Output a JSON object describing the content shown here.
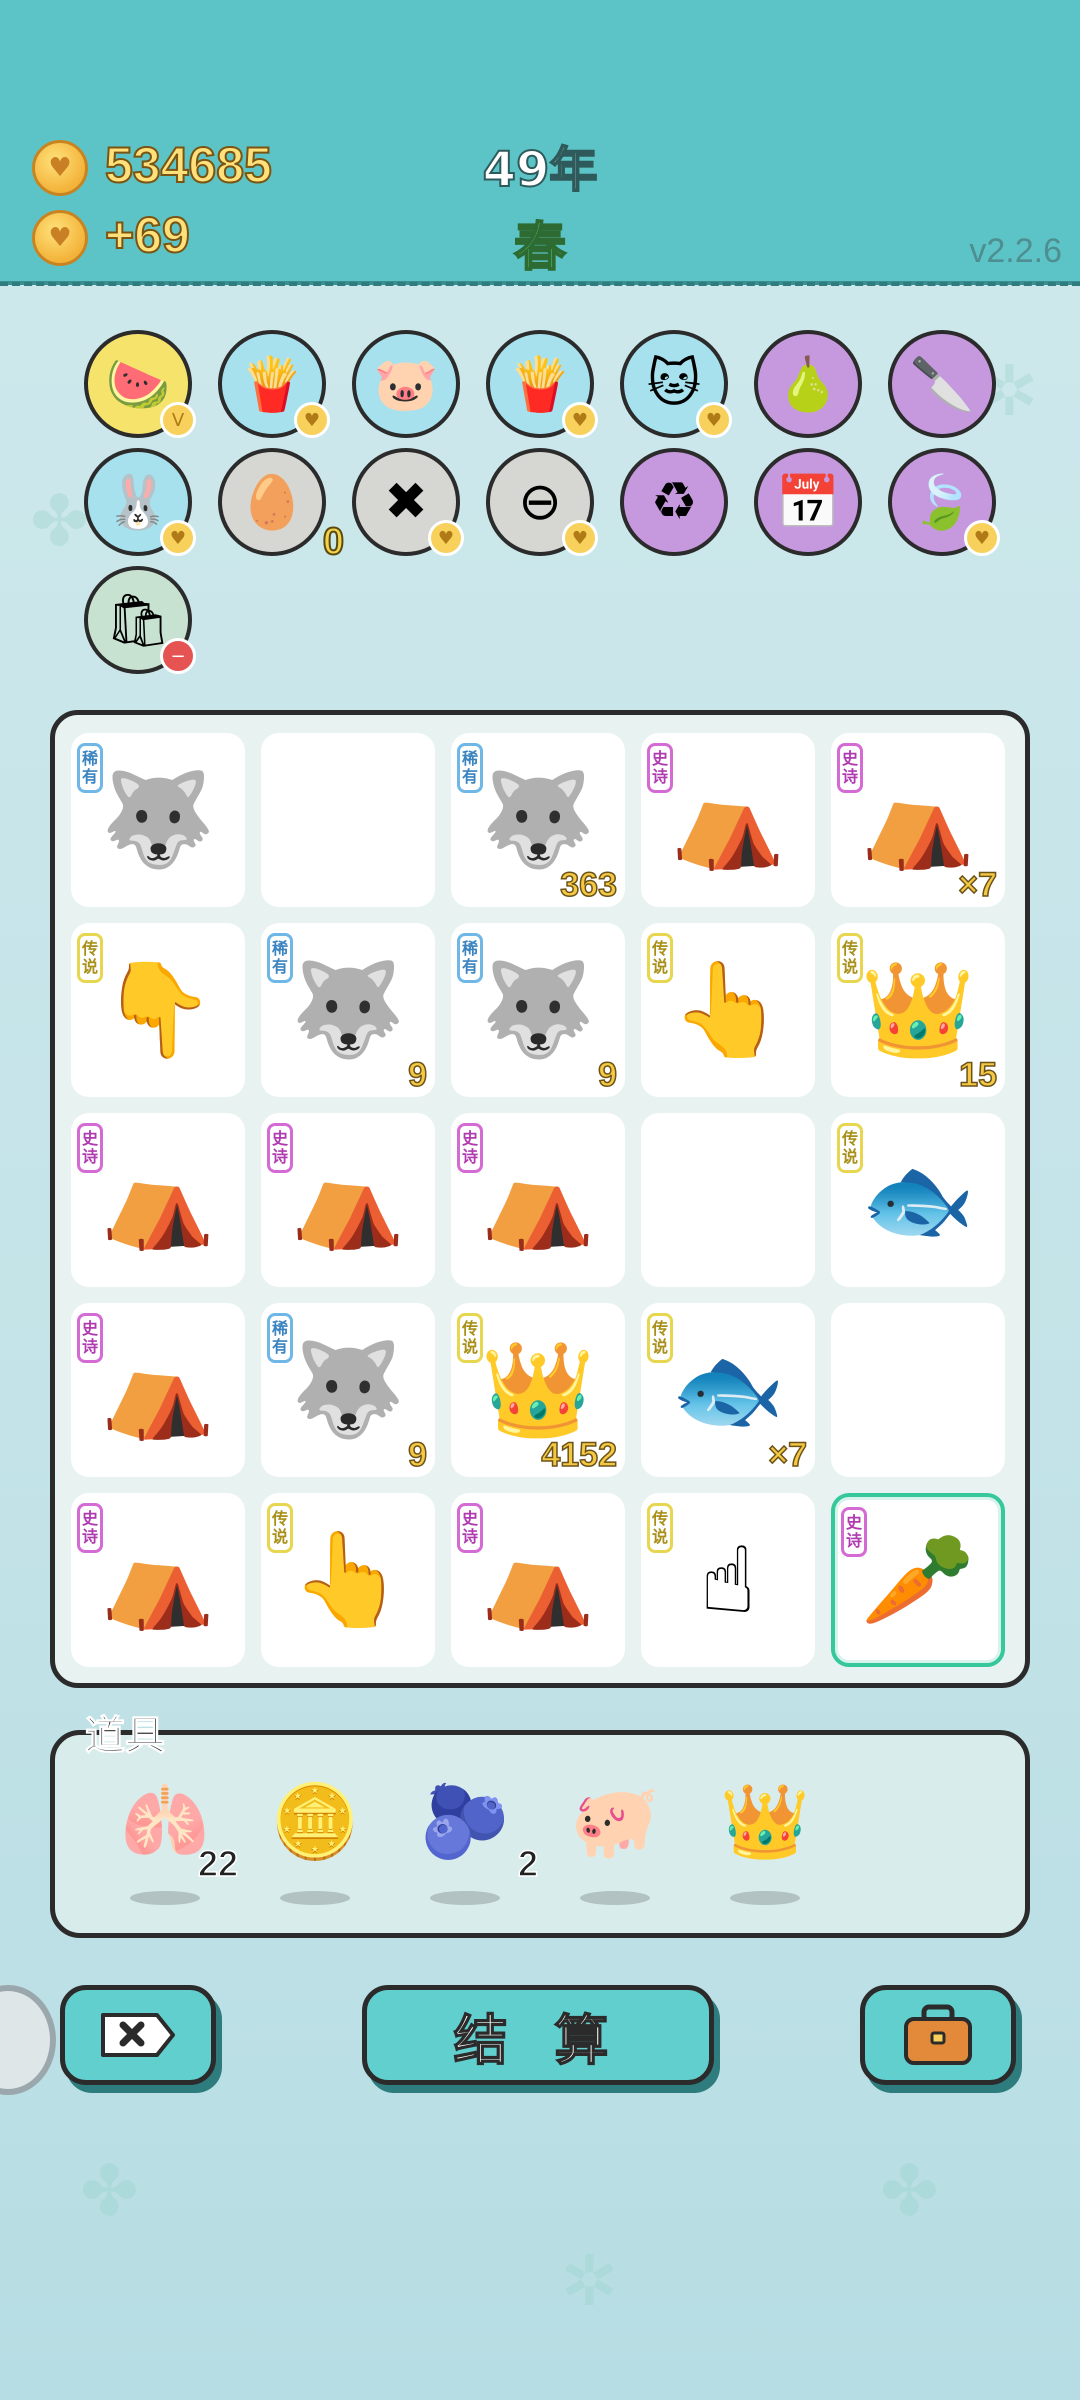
{
  "header": {
    "coins": "534685",
    "income": "+69",
    "year": "49年",
    "season": "春",
    "version": "v2.2.6",
    "coin_icon": "heart-coin-icon"
  },
  "upgrades": [
    {
      "icon": "fruit-basket",
      "glyph": "🍉",
      "color": "yellow",
      "badge": "V"
    },
    {
      "icon": "fries",
      "glyph": "🍟",
      "color": "blue",
      "badge": "♥"
    },
    {
      "icon": "piggy-bank",
      "glyph": "🐷",
      "color": "blue",
      "badge": ""
    },
    {
      "icon": "fries",
      "glyph": "🍟",
      "color": "blue",
      "badge": "♥"
    },
    {
      "icon": "cat-head",
      "glyph": "🐱",
      "color": "blue",
      "badge": "♥"
    },
    {
      "icon": "pomelo",
      "glyph": "🍐",
      "color": "purple",
      "badge": ""
    },
    {
      "icon": "cleaver",
      "glyph": "🔪",
      "color": "purple",
      "badge": ""
    },
    {
      "icon": "rabbit",
      "glyph": "🐰",
      "color": "blue",
      "badge": "♥"
    },
    {
      "icon": "egg-tray",
      "glyph": "🥚",
      "color": "grey",
      "badge": "",
      "num": "0"
    },
    {
      "icon": "remove-tag",
      "glyph": "✖",
      "color": "grey",
      "badge": "♥"
    },
    {
      "icon": "minus-circle",
      "glyph": "⊖",
      "color": "grey",
      "badge": "♥"
    },
    {
      "icon": "recycle",
      "glyph": "♻",
      "color": "purple",
      "badge": ""
    },
    {
      "icon": "calendar",
      "glyph": "📅",
      "color": "purple",
      "badge": ""
    },
    {
      "icon": "leaf",
      "glyph": "🍃",
      "color": "purple",
      "badge": "♥"
    },
    {
      "icon": "bag",
      "glyph": "🛍",
      "color": "lgreen",
      "badge": "−"
    }
  ],
  "board": {
    "cells": [
      {
        "rarity": "稀有",
        "rarity_type": "rare",
        "icon": "husky",
        "glyph": "🐺",
        "count": ""
      },
      {
        "rarity": "",
        "rarity_type": "",
        "icon": "empty",
        "glyph": "",
        "count": ""
      },
      {
        "rarity": "稀有",
        "rarity_type": "rare",
        "icon": "husky",
        "glyph": "🐺",
        "count": "363"
      },
      {
        "rarity": "史诗",
        "rarity_type": "epic",
        "icon": "rabbit-tent",
        "glyph": "⛺",
        "count": ""
      },
      {
        "rarity": "史诗",
        "rarity_type": "epic",
        "icon": "rabbit-tent",
        "glyph": "⛺",
        "count": "×7"
      },
      {
        "rarity": "传说",
        "rarity_type": "legend",
        "icon": "pointing-hand",
        "glyph": "👇",
        "count": ""
      },
      {
        "rarity": "稀有",
        "rarity_type": "rare",
        "icon": "husky",
        "glyph": "🐺",
        "count": "9"
      },
      {
        "rarity": "稀有",
        "rarity_type": "rare",
        "icon": "husky",
        "glyph": "🐺",
        "count": "9"
      },
      {
        "rarity": "传说",
        "rarity_type": "legend",
        "icon": "pointing-hand",
        "glyph": "👆",
        "count": ""
      },
      {
        "rarity": "传说",
        "rarity_type": "legend",
        "icon": "crowned-husky",
        "glyph": "👑",
        "count": "15"
      },
      {
        "rarity": "史诗",
        "rarity_type": "epic",
        "icon": "rabbit-tent",
        "glyph": "⛺",
        "count": ""
      },
      {
        "rarity": "史诗",
        "rarity_type": "epic",
        "icon": "rabbit-tent",
        "glyph": "⛺",
        "count": ""
      },
      {
        "rarity": "史诗",
        "rarity_type": "epic",
        "icon": "rabbit-tent",
        "glyph": "⛺",
        "count": ""
      },
      {
        "rarity": "",
        "rarity_type": "",
        "icon": "empty",
        "glyph": "",
        "count": ""
      },
      {
        "rarity": "传说",
        "rarity_type": "legend",
        "icon": "koi-fish",
        "glyph": "🐟",
        "count": ""
      },
      {
        "rarity": "史诗",
        "rarity_type": "epic",
        "icon": "rabbit-tent",
        "glyph": "⛺",
        "count": ""
      },
      {
        "rarity": "稀有",
        "rarity_type": "rare",
        "icon": "husky",
        "glyph": "🐺",
        "count": "9"
      },
      {
        "rarity": "传说",
        "rarity_type": "legend",
        "icon": "crowned-husky",
        "glyph": "👑",
        "count": "4152"
      },
      {
        "rarity": "传说",
        "rarity_type": "legend",
        "icon": "koi-fish",
        "glyph": "🐟",
        "count": "×7"
      },
      {
        "rarity": "",
        "rarity_type": "",
        "icon": "empty",
        "glyph": "",
        "count": ""
      },
      {
        "rarity": "史诗",
        "rarity_type": "epic",
        "icon": "rabbit-tent",
        "glyph": "⛺",
        "count": ""
      },
      {
        "rarity": "传说",
        "rarity_type": "legend",
        "icon": "pointing-hand",
        "glyph": "👆",
        "count": ""
      },
      {
        "rarity": "史诗",
        "rarity_type": "epic",
        "icon": "rabbit-tent",
        "glyph": "⛺",
        "count": ""
      },
      {
        "rarity": "传说",
        "rarity_type": "legend",
        "icon": "pointing-hand",
        "glyph": "☝",
        "count": ""
      },
      {
        "rarity": "史诗",
        "rarity_type": "epic",
        "icon": "carrot",
        "glyph": "🥕",
        "count": "",
        "selected": true
      }
    ]
  },
  "items": {
    "title": "道具",
    "list": [
      {
        "icon": "liver",
        "glyph": "🫁",
        "count": "22"
      },
      {
        "icon": "dollar-coin",
        "glyph": "🪙",
        "count": ""
      },
      {
        "icon": "blueberry",
        "glyph": "🫐",
        "count": "2"
      },
      {
        "icon": "piggy-bank",
        "glyph": "🐖",
        "count": ""
      },
      {
        "icon": "crown",
        "glyph": "👑",
        "count": ""
      }
    ]
  },
  "buttons": {
    "remove_icon": "remove-tag-icon",
    "settle_label": "结 算",
    "bag_icon": "briefcase-icon"
  }
}
